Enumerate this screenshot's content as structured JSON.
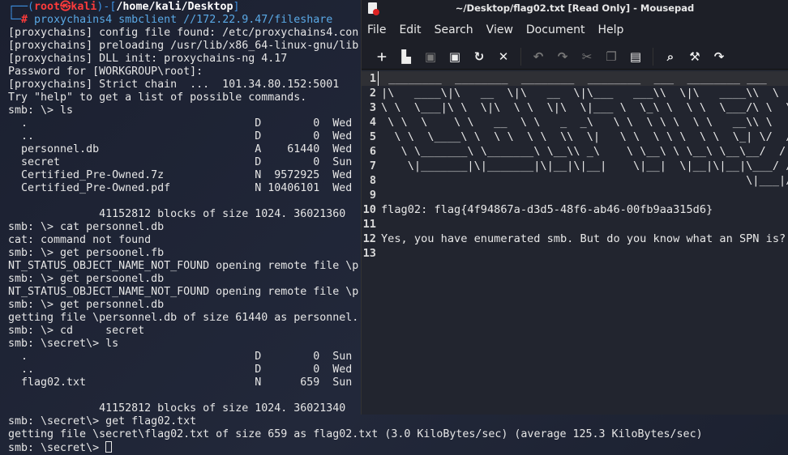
{
  "terminal": {
    "prompt": {
      "user": "root",
      "host": "kali",
      "path": "/home/kali/Desktop",
      "command": "proxychains4 smbclient //172.22.9.47/fileshare"
    },
    "lines": [
      "[proxychains] config file found: /etc/proxychains4.con",
      "[proxychains] preloading /usr/lib/x86_64-linux-gnu/lib",
      "[proxychains] DLL init: proxychains-ng 4.17",
      "Password for [WORKGROUP\\root]:",
      "[proxychains] Strict chain  ...  101.34.80.152:5001",
      "Try \"help\" to get a list of possible commands.",
      "smb: \\> ls",
      "  .                                   D        0  Wed",
      "  ..                                  D        0  Wed",
      "  personnel.db                        A    61440  Wed",
      "  secret                              D        0  Sun",
      "  Certified_Pre-Owned.7z              N  9572925  Wed",
      "  Certified_Pre-Owned.pdf             N 10406101  Wed",
      "",
      "              41152812 blocks of size 1024. 36021360",
      "smb: \\> cat personnel.db",
      "cat: command not found",
      "smb: \\> get persoonel.fb",
      "NT_STATUS_OBJECT_NAME_NOT_FOUND opening remote file \\p",
      "smb: \\> get persoonel.db",
      "NT_STATUS_OBJECT_NAME_NOT_FOUND opening remote file \\p",
      "smb: \\> get personnel.db",
      "getting file \\personnel.db of size 61440 as personnel.",
      "smb: \\> cd     secret",
      "smb: \\secret\\> ls",
      "  .                                   D        0  Sun",
      "  ..                                  D        0  Wed",
      "  flag02.txt                          N      659  Sun",
      "",
      "              41152812 blocks of size 1024. 36021340",
      "smb: \\secret\\> get flag02.txt",
      "getting file \\secret\\flag02.txt of size 659 as flag02.txt (3.0 KiloBytes/sec) (average 125.3 KiloBytes/sec)",
      "smb: \\secret\\> "
    ]
  },
  "mousepad": {
    "title": "~/Desktop/flag02.txt [Read Only] - Mousepad",
    "menu": [
      "File",
      "Edit",
      "Search",
      "View",
      "Document",
      "Help"
    ],
    "toolbar": [
      "new-document",
      "new-window",
      "save",
      "save-as",
      "reload",
      "close",
      "undo",
      "redo",
      "cut",
      "copy",
      "paste",
      "find",
      "find-replace",
      "go-to"
    ],
    "lines": [
      " ________  ________  ________  ________  ___  ________ ___",
      "|\\   ____\\|\\   __  \\|\\   __  \\|\\___   ___\\\\  \\|\\   ____\\\\  \\  /",
      "\\ \\  \\___|\\ \\  \\|\\  \\ \\  \\|\\  \\|___ \\  \\_\\ \\  \\ \\  \\___/\\ \\  \\/",
      " \\ \\  \\    \\ \\   __  \\ \\   _  _\\   \\ \\  \\ \\ \\  \\ \\   __\\\\ \\",
      "  \\ \\  \\____\\ \\  \\ \\  \\ \\  \\\\  \\|   \\ \\  \\ \\ \\  \\ \\  \\_| \\/  /",
      "   \\ \\_______\\ \\_______\\ \\__\\\\ _\\    \\ \\__\\ \\ \\__\\ \\__\\__/  / /",
      "    \\|_______|\\|_______|\\|__|\\|__|    \\|__|  \\|__|\\|__|\\___/ /",
      "                                                       \\|___|/",
      "",
      "flag02: flag{4f94867a-d3d5-48f6-ab46-00fb9aa315d6}",
      "",
      "Yes, you have enumerated smb. But do you know what an SPN is?",
      ""
    ]
  }
}
